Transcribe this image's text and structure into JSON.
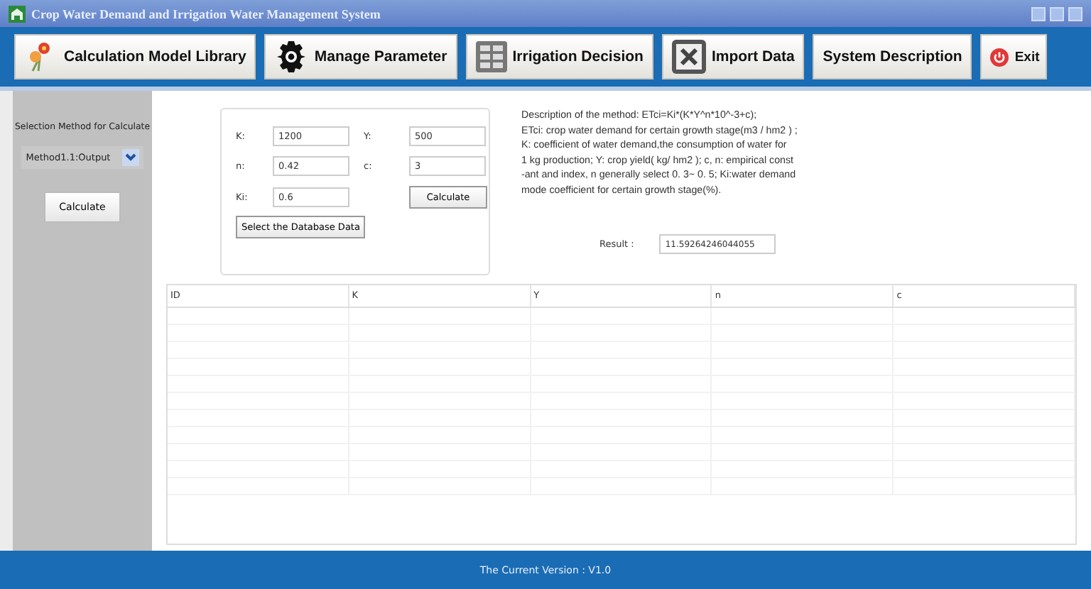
{
  "window": {
    "title": "Crop Water Demand and Irrigation Water Management System"
  },
  "toolbar": [
    {
      "label": "Calculation Model Library",
      "kind": "flower"
    },
    {
      "label": "Manage Parameter",
      "kind": "gear"
    },
    {
      "label": "Irrigation Decision",
      "kind": "grid"
    },
    {
      "label": "Import Data",
      "kind": "sheet"
    },
    {
      "label": "System Description",
      "kind": "none"
    },
    {
      "label": "Exit",
      "kind": "power"
    }
  ],
  "sidebar": {
    "label": "Selection Method for Calculate",
    "method": "Method1.1:Output",
    "button": "Calculate"
  },
  "parameters": {
    "fields": [
      {
        "label": "K:",
        "value": "1200"
      },
      {
        "label": "Y:",
        "value": "500"
      },
      {
        "label": "n:",
        "value": "0.42"
      },
      {
        "label": "c:",
        "value": "3"
      },
      {
        "label": "Ki:",
        "value": "0.6"
      }
    ],
    "calculate": "Calculate",
    "select": "Select the Database Data"
  },
  "description": "Description of the method: ETci=Ki*(K*Y^n*10^-3+c);\n ETci: crop water demand for certain growth stage(m3 / hm2 ) ;\n K: coefficient of water demand,the consumption of water for\n 1 kg production; Y: crop yield( kg/ hm2 ); c, n: empirical const\n-ant and index, n generally select 0. 3~ 0. 5; Ki:water demand\nmode coefficient for certain growth stage(%).",
  "result": {
    "label": "Result :",
    "value": "11.59264246044055"
  },
  "table": {
    "columns": [
      "ID",
      "K",
      "Y",
      "n",
      "c"
    ]
  },
  "status_bar": "The Current Version : V1.0"
}
